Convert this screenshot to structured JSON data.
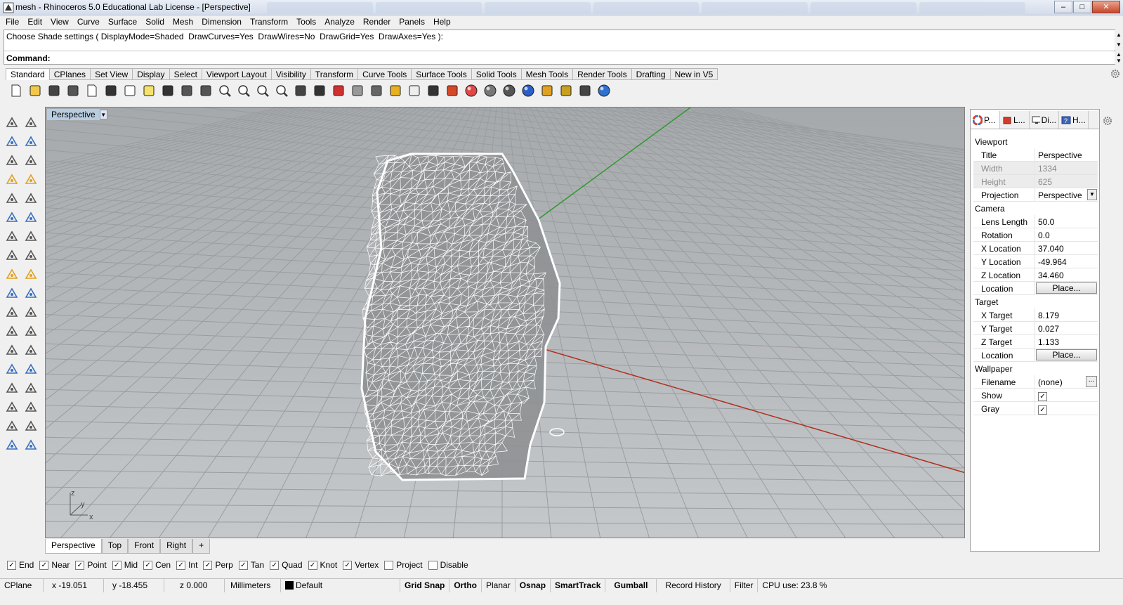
{
  "window": {
    "title": "mesh - Rhinoceros 5.0 Educational Lab License - [Perspective]"
  },
  "menu": [
    "File",
    "Edit",
    "View",
    "Curve",
    "Surface",
    "Solid",
    "Mesh",
    "Dimension",
    "Transform",
    "Tools",
    "Analyze",
    "Render",
    "Panels",
    "Help"
  ],
  "command": {
    "history": "Choose Shade settings ( DisplayMode=Shaded  DrawCurves=Yes  DrawWires=No  DrawGrid=Yes  DrawAxes=Yes ):",
    "prompt": "Command:"
  },
  "toolbar_tabs": [
    "Standard",
    "CPlanes",
    "Set View",
    "Display",
    "Select",
    "Viewport Layout",
    "Visibility",
    "Transform",
    "Curve Tools",
    "Surface Tools",
    "Solid Tools",
    "Mesh Tools",
    "Render Tools",
    "Drafting",
    "New in V5"
  ],
  "toolbar_icons": [
    "new-icon",
    "open-icon",
    "save-icon",
    "print-icon",
    "import-icon",
    "cut-icon",
    "copy-icon",
    "paste-icon",
    "undo-icon",
    "pan-icon",
    "move-icon",
    "zoom-icon",
    "zoom-window-icon",
    "zoom-extents-icon",
    "zoom-selected-icon",
    "rotate-view-icon",
    "four-viewports-icon",
    "car-icon",
    "car-outline-icon",
    "select-icon",
    "gumball-icon",
    "light-icon",
    "lock-icon",
    "layer-icon",
    "color-wheel-icon",
    "sphere-gray-icon",
    "sphere-shaded-icon",
    "sphere-blue-icon",
    "render-icon",
    "options-icon",
    "snap-icon",
    "help-icon"
  ],
  "viewport": {
    "title": "Perspective",
    "axis_z": "z",
    "axis_y": "y",
    "axis_x": "x"
  },
  "viewport_tabs": [
    "Perspective",
    "Top",
    "Front",
    "Right",
    "+"
  ],
  "osnaps": [
    {
      "label": "End",
      "checked": true
    },
    {
      "label": "Near",
      "checked": true
    },
    {
      "label": "Point",
      "checked": true
    },
    {
      "label": "Mid",
      "checked": true
    },
    {
      "label": "Cen",
      "checked": true
    },
    {
      "label": "Int",
      "checked": true
    },
    {
      "label": "Perp",
      "checked": true
    },
    {
      "label": "Tan",
      "checked": true
    },
    {
      "label": "Quad",
      "checked": true
    },
    {
      "label": "Knot",
      "checked": true
    },
    {
      "label": "Vertex",
      "checked": true
    },
    {
      "label": "Project",
      "checked": false
    },
    {
      "label": "Disable",
      "checked": false
    }
  ],
  "status": {
    "cplane": "CPlane",
    "x": "x -19.051",
    "y": "y -18.455",
    "z": "z 0.000",
    "units": "Millimeters",
    "layer": "Default",
    "toggles": [
      "Grid Snap",
      "Ortho",
      "Planar",
      "Osnap",
      "SmartTrack",
      "Gumball",
      "Record History",
      "Filter"
    ],
    "cpu": "CPU use: 23.8 %"
  },
  "panel": {
    "tabs": [
      "P...",
      "L...",
      "Di...",
      "H..."
    ],
    "viewport_section": "Viewport",
    "viewport_rows": [
      {
        "k": "Title",
        "v": "Perspective"
      },
      {
        "k": "Width",
        "v": "1334"
      },
      {
        "k": "Height",
        "v": "625"
      },
      {
        "k": "Projection",
        "v": "Perspective"
      }
    ],
    "camera_section": "Camera",
    "camera_rows": [
      {
        "k": "Lens Length",
        "v": "50.0"
      },
      {
        "k": "Rotation",
        "v": "0.0"
      },
      {
        "k": "X Location",
        "v": "37.040"
      },
      {
        "k": "Y Location",
        "v": "-49.964"
      },
      {
        "k": "Z Location",
        "v": "34.460"
      },
      {
        "k": "Location",
        "v": "Place..."
      }
    ],
    "target_section": "Target",
    "target_rows": [
      {
        "k": "X Target",
        "v": "8.179"
      },
      {
        "k": "Y Target",
        "v": "0.027"
      },
      {
        "k": "Z Target",
        "v": "1.133"
      },
      {
        "k": "Location",
        "v": "Place..."
      }
    ],
    "wallpaper_section": "Wallpaper",
    "wallpaper_rows": [
      {
        "k": "Filename",
        "v": "(none)"
      },
      {
        "k": "Show",
        "v": ""
      },
      {
        "k": "Gray",
        "v": ""
      }
    ]
  },
  "colors": {
    "x_axis": "#b03020",
    "y_axis": "#2f9a2f",
    "mesh_wire": "#ffffff",
    "viewport_bg": "#b4b7ba"
  }
}
